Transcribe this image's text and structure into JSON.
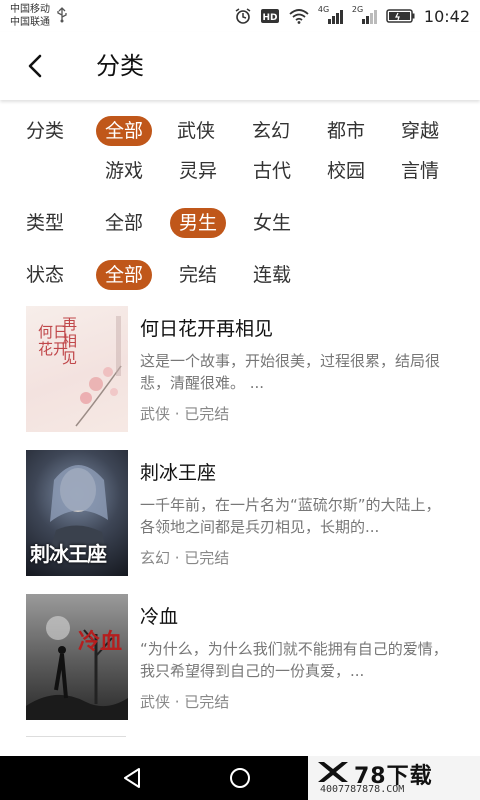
{
  "status_bar": {
    "carrier_1": "中国移动",
    "carrier_2": "中国联通",
    "network_1": "4G",
    "network_2": "2G",
    "clock": "10:42",
    "icons": [
      "usb-icon",
      "alarm-icon",
      "hd-icon",
      "wifi-icon",
      "signal-icon",
      "battery-icon"
    ]
  },
  "header": {
    "title": "分类",
    "back_icon": "chevron-left-icon"
  },
  "filters": {
    "category": {
      "label": "分类",
      "options": [
        "全部",
        "武侠",
        "玄幻",
        "都市",
        "穿越",
        "游戏",
        "灵异",
        "古代",
        "校园",
        "言情"
      ],
      "selected": "全部"
    },
    "type": {
      "label": "类型",
      "options": [
        "全部",
        "男生",
        "女生"
      ],
      "selected": "男生"
    },
    "status": {
      "label": "状态",
      "options": [
        "全部",
        "完结",
        "连载"
      ],
      "selected": "全部"
    },
    "accent_color": "#c0571a"
  },
  "books": [
    {
      "title": "何日花开再相见",
      "desc": "这是一个故事，开始很美，过程很累，结局很悲，清醒很难。 ...",
      "meta": "武侠 · 已完结",
      "cover_text_a": "再相见",
      "cover_text_b": "何日花开"
    },
    {
      "title": "刺冰王座",
      "desc": "一千年前，在一片名为“蓝硫尔斯”的大陆上，各领地之间都是兵刃相见，长期的...",
      "meta": "玄幻 · 已完结",
      "cover_text": "刺冰王座"
    },
    {
      "title": "冷血",
      "desc": "“为什么，为什么我们就不能拥有自己的爱情，我只希望得到自己的一份真爱，...",
      "meta": "武侠 · 已完结",
      "cover_text": "冷血"
    }
  ],
  "nav_bar": {
    "buttons": [
      "back-triangle-icon",
      "home-circle-icon"
    ],
    "watermark_text": "78下载",
    "watermark_sub": "4007787878.COM"
  }
}
